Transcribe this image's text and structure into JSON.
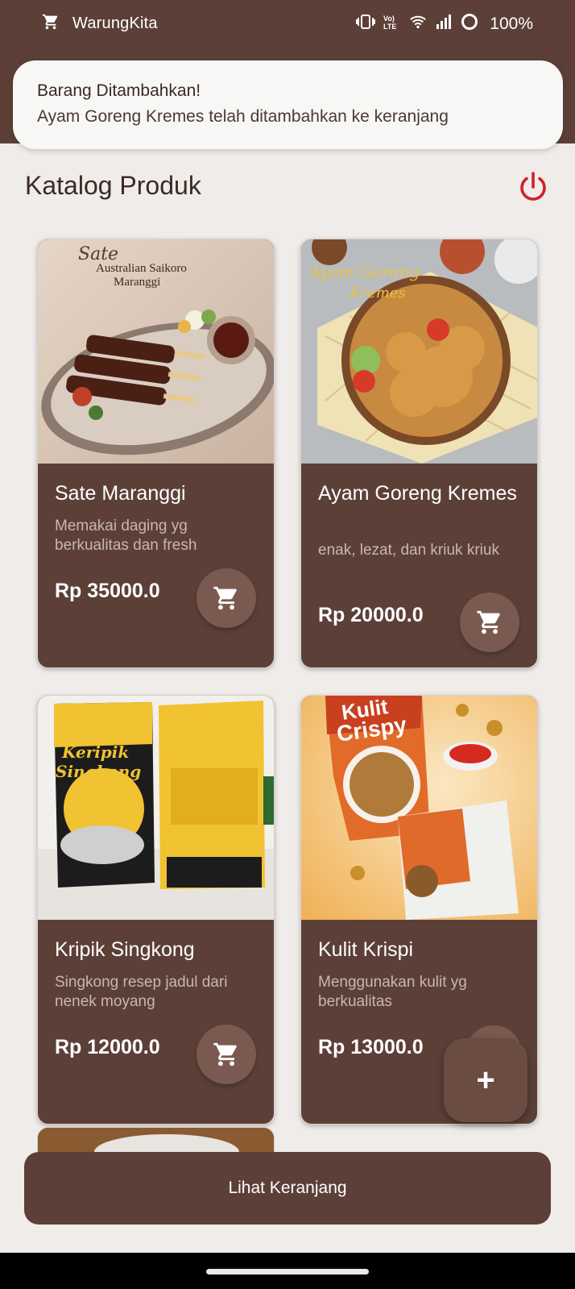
{
  "status_bar": {
    "app_name": "WarungKita",
    "volte_label": "Vo) LTE",
    "battery": "100%"
  },
  "notification": {
    "title": "Barang Ditambahkan!",
    "body": "Ayam Goreng Kremes telah ditambahkan ke keranjang"
  },
  "page": {
    "title": "Katalog Produk"
  },
  "products": [
    {
      "name": "Sate Maranggi",
      "description": "Memakai daging yg berkualitas dan fresh",
      "price": "Rp 35000.0",
      "image_caption_1": "Sate",
      "image_caption_2": "Australian Saikoro",
      "image_caption_3": "Maranggi"
    },
    {
      "name": "Ayam Goreng Kremes",
      "description": "enak, lezat, dan kriuk kriuk",
      "price": "Rp 20000.0",
      "image_caption_1": "Ayam Goreng",
      "image_caption_2": "Kremes"
    },
    {
      "name": "Kripik Singkong",
      "description": "Singkong resep jadul dari nenek moyang",
      "price": "Rp 12000.0",
      "image_caption_1": "Keripik",
      "image_caption_2": "Singkong"
    },
    {
      "name": "Kulit Krispi",
      "description": "Menggunakan kulit yg berkualitas",
      "price": "Rp 13000.0",
      "image_caption_1": "Kulit",
      "image_caption_2": "Crispy"
    }
  ],
  "fab": {
    "label": "+"
  },
  "bottom": {
    "view_cart_label": "Lihat Keranjang"
  },
  "colors": {
    "primary": "#5c4037",
    "card_button": "#7a5a50",
    "power_icon": "#d0202a",
    "background": "#efecea"
  },
  "icons": {
    "cart": "cart-icon",
    "power": "power-icon",
    "add": "plus-icon"
  }
}
